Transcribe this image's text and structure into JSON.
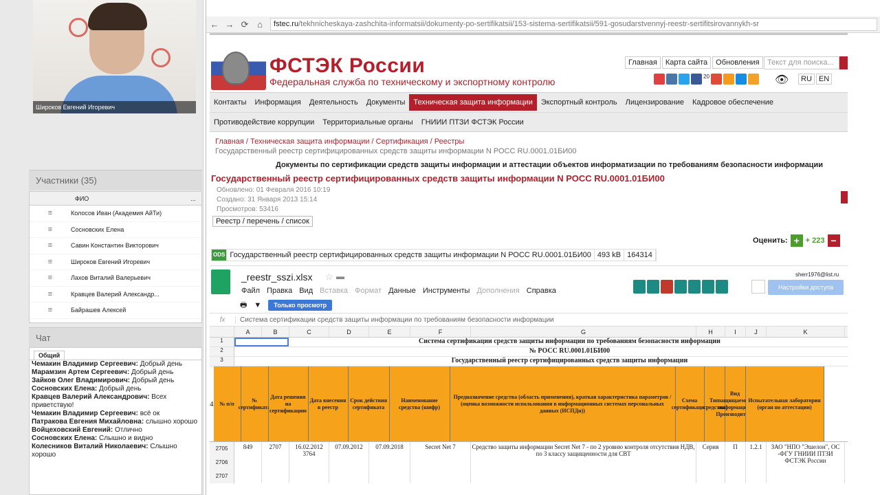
{
  "video": {
    "presenter": "Широков Евгений Игоревич"
  },
  "participants": {
    "title": "Участники (35)",
    "col": "ФИО",
    "more": "...",
    "items": [
      "Колосов Иван (Академия АйТи)",
      "Сосновских Елена",
      "Савин Константин Викторович",
      "Широков Евгений Игоревич",
      "Лахов Виталий Валерьевич",
      "Кравцев Валерий Александр...",
      "Байрашев Алексей"
    ]
  },
  "chat": {
    "title": "Чат",
    "tab": "Общий",
    "messages": [
      {
        "a": "Чемакин Владимир Сергеевич:",
        "t": "Добрый день"
      },
      {
        "a": "Марамзин Артем Сергеевич:",
        "t": "Добрый день"
      },
      {
        "a": "Зайков Олег Владимирович:",
        "t": "Добрый день"
      },
      {
        "a": "Сосновских Елена:",
        "t": "Добрый день"
      },
      {
        "a": "Кравцев Валерий Александрович:",
        "t": "Всех приветствую!"
      },
      {
        "a": "Чемакин Владимир Сергеевич:",
        "t": "всё ок"
      },
      {
        "a": "Патракова Евгения Михайловна:",
        "t": "слышно хорошо"
      },
      {
        "a": "Войцеховский Евгений:",
        "t": "Отлично"
      },
      {
        "a": "Сосновских Елена:",
        "t": "Слышно и видно"
      },
      {
        "a": "Колесников Виталий Николаевич:",
        "t": "Слышно хорошо"
      }
    ]
  },
  "browser": {
    "url_domain": "fstec.ru",
    "url_rest": "/tekhnicheskaya-zashchita-informatsii/dokumenty-po-sertifikatsii/153-sistema-sertifikatsii/591-gosudarstvennyj-reestr-sertifitsirovannykh-sr"
  },
  "site": {
    "title": "ФСТЭК России",
    "subtitle": "Федеральная служба по техническому и экспортному контролю",
    "toplinks": [
      "Главная",
      "Карта сайта",
      "Обновления"
    ],
    "search_placeholder": "Текст для поиска...",
    "social_count": "20",
    "lang": [
      "RU",
      "EN"
    ]
  },
  "menu": {
    "row1": [
      "Контакты",
      "Информация",
      "Деятельность",
      "Документы",
      "Техническая защита информации",
      "Экспортный контроль",
      "Лицензирование",
      "Кадровое обеспечение"
    ],
    "row2": [
      "Противодействие коррупции",
      "Территориальные органы",
      "ГНИИИ ПТЗИ ФСТЭК России"
    ]
  },
  "breadcrumbs": {
    "items": [
      "Главная",
      "Техническая защита информации",
      "Сертификация",
      "Реестры"
    ],
    "current": "Государственный реестр сертифицированных средств защиты информации N РОСС RU.0001.01БИ00"
  },
  "doc": {
    "section": "Документы по сертификации средств защиты информации и аттестации объектов информатизации по требованиям безопасности информации",
    "title": "Государственный реестр сертифицированных средств защиты информации N РОСС RU.0001.01БИ00",
    "updated": "Обновлено: 01 Февраля 2016 10:19",
    "created": "Создано: 31 Января 2013 15:14",
    "views": "Просмотров: 53416",
    "tab": "Реестр / перечень / список",
    "rate_label": "Оценить:",
    "rate_count": "+ 223"
  },
  "file": {
    "badge": "ODS",
    "name": "Государственный реестр сертифицированных средств защиты информации N РОСС RU.0001.01БИ00",
    "size": "493 kB",
    "downloads": "164314"
  },
  "sheet": {
    "name": "_reestr_sszi.xlsx",
    "owner": "sherr1976@list.ru",
    "share": "Настройки доступа",
    "viewonly": "Только просмотр",
    "menu": [
      "Файл",
      "Правка",
      "Вид",
      "Вставка",
      "Формат",
      "Данные",
      "Инструменты",
      "Дополнения",
      "Справка"
    ],
    "formula": "Система сертификации средств защиты информации по требованиям безопасности информации",
    "cols": [
      "A",
      "B",
      "C",
      "D",
      "E",
      "F",
      "G",
      "H",
      "I",
      "J",
      "K"
    ],
    "rows": [
      "1",
      "2",
      "3",
      "4",
      "2705",
      "2706",
      "2707"
    ],
    "r1": "Система сертификации средств защиты информации по требованиям безопасности информации",
    "r2": "№ РОСС RU.0001.01БИ00",
    "r3": "Государственный реестр сертифицированных средств защиты информации",
    "headers": [
      "№ п/п",
      "№ сертификата",
      "Дата решения на сертификацию",
      "Дата внесения в реестр",
      "Срок действия сертификата",
      "Наименование средства (шифр)",
      "Предназначение средства (область применения), краткая характеристика параметров / (оценка возможности использования в информационных системах персональных данных (ИСПДн))",
      "Схема сертификации",
      "Тип средства",
      "Вид защищаемой информации/Производитель",
      "Испытательная лаборатория (орган по аттестации)"
    ],
    "data": [
      "849",
      "2707",
      "16.02.2012 3764",
      "07.09.2012",
      "07.09.2018",
      "Secret Net 7",
      "Средство защиты информации Secret Net 7 - по 2 уровню контроля отсутствия НДВ, по 3 классу защищенности для СВТ",
      "Серия",
      "П",
      "1.2.1",
      "ЗАО \"НПО \"Эшелон\", ОС -ФГУ ГНИИИ ПТЗИ ФСТЭК России"
    ]
  }
}
